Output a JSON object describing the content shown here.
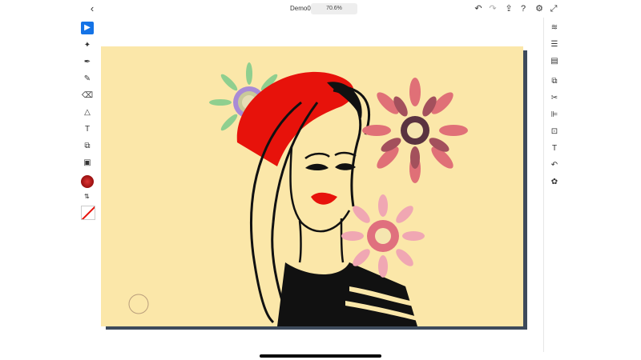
{
  "app": {
    "document_title": "Demo001",
    "zoom": "70.6%"
  },
  "top_bar": {
    "back": "back",
    "icons": [
      "undo-icon",
      "redo-icon",
      "share-icon",
      "help-icon",
      "settings-icon",
      "export-icon"
    ]
  },
  "left_tools": [
    {
      "name": "select-tool",
      "icon": "▶",
      "active": true
    },
    {
      "name": "magic-select-tool",
      "icon": "✦",
      "active": false
    },
    {
      "name": "pen-tool",
      "icon": "✒",
      "active": false
    },
    {
      "name": "pencil-tool",
      "icon": "✎",
      "active": false
    },
    {
      "name": "eraser-tool",
      "icon": "⌫",
      "active": false
    },
    {
      "name": "shape-tool",
      "icon": "△",
      "active": false
    },
    {
      "name": "text-tool",
      "icon": "T",
      "active": false
    },
    {
      "name": "crop-tool",
      "icon": "⧉",
      "active": false
    },
    {
      "name": "image-tool",
      "icon": "▣",
      "active": false
    }
  ],
  "right_tools": [
    {
      "name": "layers-icon",
      "icon": "≋"
    },
    {
      "name": "properties-icon",
      "icon": "☰"
    },
    {
      "name": "libraries-icon",
      "icon": "▤"
    },
    {
      "name": "combine-icon",
      "icon": "⧉"
    },
    {
      "name": "cut-icon",
      "icon": "✂"
    },
    {
      "name": "align-icon",
      "icon": "⊫"
    },
    {
      "name": "transform-icon",
      "icon": "⊡"
    },
    {
      "name": "type-icon",
      "icon": "T"
    },
    {
      "name": "curve-icon",
      "icon": "↶"
    },
    {
      "name": "bug-icon",
      "icon": "✿"
    }
  ],
  "colors": {
    "accent": "#1473e6",
    "artboard_background": "#fbe7a9",
    "shadow": "#3d4a5b",
    "beret": "#e7120b",
    "lips": "#e7120b",
    "outline": "#111111"
  }
}
